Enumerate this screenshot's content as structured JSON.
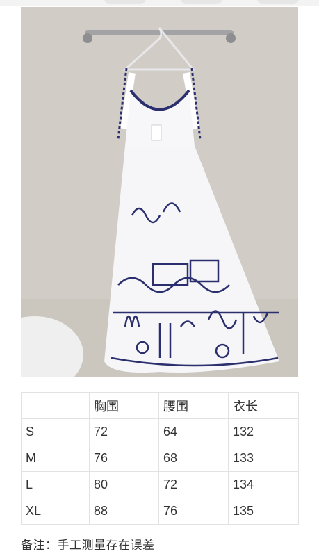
{
  "photo": {
    "subject": "white-sleeveless-dress-with-blue-embroidery",
    "colors": {
      "wall": "#d2cec7",
      "dress": "#f7f7f9",
      "embroidery": "#2b2f6e",
      "rail": "#9a9a9c"
    }
  },
  "size_table": {
    "headers": [
      "",
      "胸围",
      "腰围",
      "衣长"
    ],
    "rows": [
      {
        "size": "S",
        "bust": "72",
        "waist": "64",
        "length": "132"
      },
      {
        "size": "M",
        "bust": "76",
        "waist": "68",
        "length": "133"
      },
      {
        "size": "L",
        "bust": "80",
        "waist": "72",
        "length": "134"
      },
      {
        "size": "XL",
        "bust": "88",
        "waist": "76",
        "length": "135"
      }
    ]
  },
  "note": "备注：手工测量存在误差"
}
